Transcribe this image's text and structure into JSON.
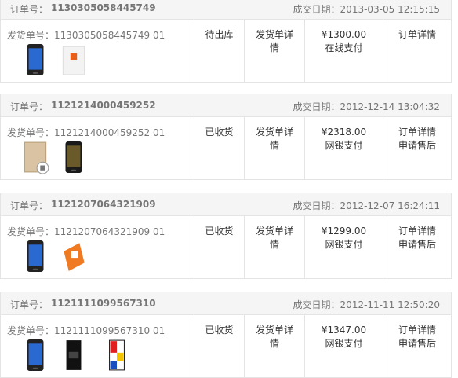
{
  "labels": {
    "order_no": "订单号：",
    "date_prefix": "成交日期：",
    "shipment_no": "发货单号："
  },
  "orders": [
    {
      "order_no": "1130305058445749",
      "date": "2013-03-05 12:15:15",
      "shipment_no": "1130305058445749 01",
      "status": "待出库",
      "shipment_detail": [
        "发货单详",
        "情"
      ],
      "amount": "¥1300.00",
      "payment": "在线支付",
      "actions": [
        "订单详情"
      ],
      "items": [
        "phone",
        "bag"
      ]
    },
    {
      "order_no": "1121214000459252",
      "date": "2012-12-14 13:04:32",
      "shipment_no": "1121214000459252 01",
      "status": "已收货",
      "shipment_detail": [
        "发货单详",
        "情"
      ],
      "amount": "¥2318.00",
      "payment": "网银支付",
      "actions": [
        "订单详情",
        "申请售后"
      ],
      "items": [
        "case",
        "phone-dark"
      ]
    },
    {
      "order_no": "1121207064321909",
      "date": "2012-12-07 16:24:11",
      "shipment_no": "1121207064321909 01",
      "status": "已收货",
      "shipment_detail": [
        "发货单详",
        "情"
      ],
      "amount": "¥1299.00",
      "payment": "网银支付",
      "actions": [
        "订单详情",
        "申请售后"
      ],
      "items": [
        "phone",
        "orange-case"
      ]
    },
    {
      "order_no": "1121111099567310",
      "date": "2012-11-11 12:50:20",
      "shipment_no": "1121111099567310 01",
      "status": "已收货",
      "shipment_detail": [
        "发货单详",
        "情"
      ],
      "amount": "¥1347.00",
      "payment": "网银支付",
      "actions": [
        "订单详情",
        "申请售后"
      ],
      "items": [
        "phone",
        "sd-card",
        "color-case"
      ]
    }
  ]
}
